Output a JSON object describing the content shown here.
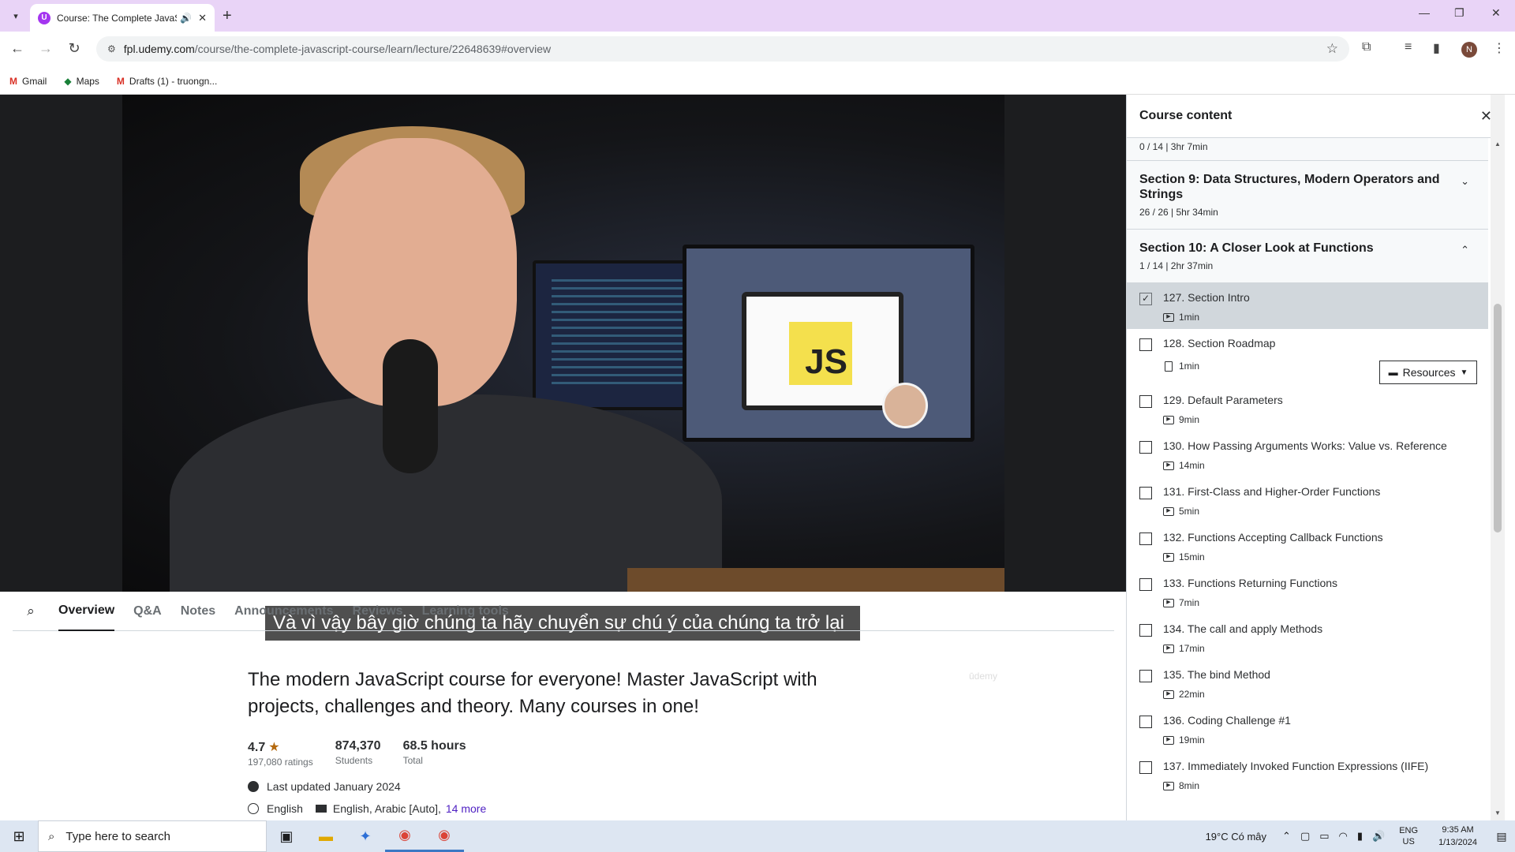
{
  "browser": {
    "tab_title": "Course: The Complete JavaS",
    "url_host": "fpl.udemy.com",
    "url_path": "/course/the-complete-javascript-course/learn/lecture/22648639#overview",
    "bookmarks": [
      {
        "icon": "gmail-icon",
        "label": "Gmail"
      },
      {
        "icon": "maps-icon",
        "label": "Maps"
      },
      {
        "icon": "gmail-icon",
        "label": "Drafts (1) - truongn..."
      }
    ],
    "profile_initial": "N"
  },
  "video": {
    "caption": "Và vì vậy bây giờ chúng ta hãy chuyển sự chú ý của chúng ta trở lại",
    "note_text": "JS",
    "watermark": "ūdemy"
  },
  "course_tabs": [
    "Overview",
    "Q&A",
    "Notes",
    "Announcements",
    "Reviews",
    "Learning tools"
  ],
  "overview": {
    "title": "The modern JavaScript course for everyone! Master JavaScript with projects, challenges and theory. Many courses in one!",
    "rating": "4.7",
    "ratings_count": "197,080 ratings",
    "students": "874,370",
    "students_label": "Students",
    "hours": "68.5 hours",
    "hours_label": "Total",
    "last_updated": "Last updated January 2024",
    "language": "English",
    "captions": "English, Arabic [Auto],",
    "more": "14 more"
  },
  "sidebar": {
    "title": "Course content",
    "prev_meta": "0 / 14 | 3hr 7min",
    "sections": [
      {
        "title": "Section 9: Data Structures, Modern Operators and Strings",
        "meta": "26 / 26 | 5hr 34min"
      },
      {
        "title": "Section 10: A Closer Look at Functions",
        "meta": "1 / 14 | 2hr 37min"
      }
    ],
    "resources_label": "Resources",
    "lectures": [
      {
        "title": "127. Section Intro",
        "dur": "1min"
      },
      {
        "title": "128. Section Roadmap",
        "dur": "1min"
      },
      {
        "title": "129. Default Parameters",
        "dur": "9min"
      },
      {
        "title": "130. How Passing Arguments Works: Value vs. Reference",
        "dur": "14min"
      },
      {
        "title": "131. First-Class and Higher-Order Functions",
        "dur": "5min"
      },
      {
        "title": "132. Functions Accepting Callback Functions",
        "dur": "15min"
      },
      {
        "title": "133. Functions Returning Functions",
        "dur": "7min"
      },
      {
        "title": "134. The call and apply Methods",
        "dur": "17min"
      },
      {
        "title": "135. The bind Method",
        "dur": "22min"
      },
      {
        "title": "136. Coding Challenge #1",
        "dur": "19min"
      },
      {
        "title": "137. Immediately Invoked Function Expressions (IIFE)",
        "dur": "8min"
      }
    ]
  },
  "taskbar": {
    "search_placeholder": "Type here to search",
    "weather": "19°C  Có mây",
    "lang_top": "ENG",
    "lang_bottom": "US",
    "time": "9:35 AM",
    "date": "1/13/2024"
  }
}
